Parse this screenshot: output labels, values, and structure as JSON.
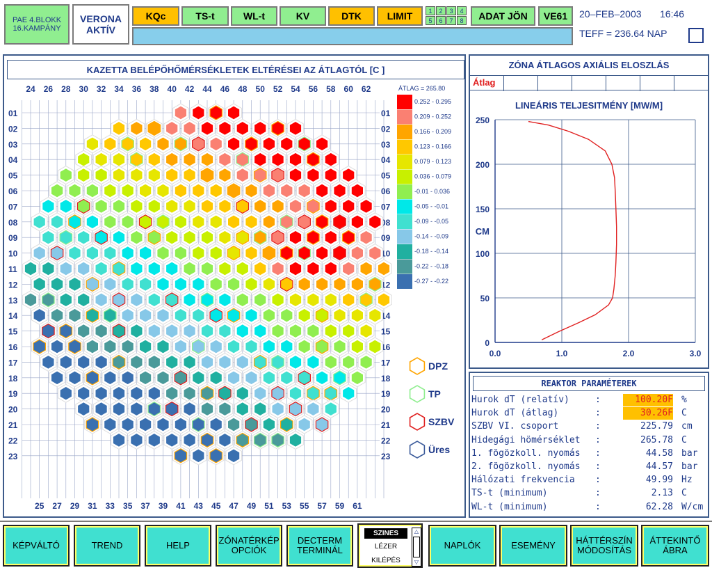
{
  "header": {
    "unit_line1": "PAE 4.BLOKK",
    "unit_line2": "16.KAMPÁNY",
    "status_line1": "VERONA",
    "status_line2": "AKTÍV",
    "buttons": [
      {
        "label": "KQc",
        "color": "yellow"
      },
      {
        "label": "TS-t",
        "color": "green"
      },
      {
        "label": "WL-t",
        "color": "green"
      },
      {
        "label": "KV",
        "color": "green"
      },
      {
        "label": "DTK",
        "color": "yellow"
      },
      {
        "label": "LIMIT",
        "color": "yellow"
      }
    ],
    "grid_numbers": [
      "1",
      "2",
      "3",
      "4",
      "5",
      "6",
      "7",
      "8"
    ],
    "adat_label": "ADAT JÖN",
    "ve_label": "VE61",
    "date": "20–FEB–2003",
    "time": "16:46",
    "teff": "TEFF = 236.64 NAP"
  },
  "map": {
    "title": "KAZETTA BELÉPŐHŐMÉRSÉKLETEK ELTÉRÉSEI AZ ÁTLAGTÓL  [C ]",
    "top_cols": [
      "24",
      "26",
      "28",
      "30",
      "32",
      "34",
      "36",
      "38",
      "40",
      "42",
      "44",
      "46",
      "48",
      "50",
      "52",
      "54",
      "56",
      "58",
      "60",
      "62"
    ],
    "bottom_cols": [
      "25",
      "27",
      "29",
      "31",
      "33",
      "35",
      "37",
      "39",
      "41",
      "43",
      "45",
      "47",
      "49",
      "51",
      "53",
      "55",
      "57",
      "59",
      "61"
    ],
    "rows": [
      "01",
      "02",
      "03",
      "04",
      "05",
      "06",
      "07",
      "08",
      "09",
      "10",
      "11",
      "12",
      "13",
      "14",
      "15",
      "16",
      "17",
      "18",
      "19",
      "20",
      "21",
      "22",
      "23"
    ],
    "legend_avg": "ÁTLAG = 265.80",
    "legend": [
      {
        "range": "0.252 -  0.295",
        "color": "#ff0000"
      },
      {
        "range": "0.209 -  0.252",
        "color": "#fa8072"
      },
      {
        "range": "0.166 -  0.209",
        "color": "#ffa500"
      },
      {
        "range": "0.123 -  0.166",
        "color": "#ffc800"
      },
      {
        "range": "0.079 -  0.123",
        "color": "#e6e600"
      },
      {
        "range": "0.036 -  0.079",
        "color": "#c8f000"
      },
      {
        "range": "-0.01 -  0.036",
        "color": "#90ee50"
      },
      {
        "range": "-0.05 -  -0.01",
        "color": "#00e8e8"
      },
      {
        "range": "-0.09 -  -0.05",
        "color": "#40e0d0"
      },
      {
        "range": "-0.14 -  -0.09",
        "color": "#87c8e8"
      },
      {
        "range": "-0.18 -  -0.14",
        "color": "#20b0a0"
      },
      {
        "range": "-0.22 -  -0.18",
        "color": "#4a9a9a"
      },
      {
        "range": "-0.27 -  -0.22",
        "color": "#3a70b0"
      }
    ],
    "types": [
      {
        "label": "DPZ",
        "color": "#ffa500"
      },
      {
        "label": "TP",
        "color": "#90ee90"
      },
      {
        "label": "SZBV",
        "color": "#e02020"
      },
      {
        "label": "Üres",
        "color": "#3a5a9a"
      }
    ]
  },
  "zone": {
    "title": "ZÓNA ÁTLAGOS AXIÁLIS ELOSZLÁS",
    "atlag": "Átlag",
    "chart_data": {
      "type": "line",
      "title": "LINEÁRIS TELJESITMÉNY [MW/M]",
      "ylabel": "CM",
      "xlim": [
        0,
        3
      ],
      "ylim": [
        0,
        250
      ],
      "xticks": [
        "0.0",
        "1.0",
        "2.0",
        "3.0"
      ],
      "yticks": [
        "0",
        "50",
        "100",
        "150",
        "200",
        "250"
      ],
      "x": [
        0.7,
        0.95,
        1.25,
        1.5,
        1.7,
        1.76,
        1.78,
        1.8,
        1.81,
        1.82,
        1.82,
        1.81,
        1.8,
        1.79,
        1.75,
        1.65,
        1.4,
        1.1,
        0.8,
        0.5
      ],
      "y": [
        3,
        12,
        22,
        31,
        42,
        50,
        60,
        75,
        90,
        110,
        130,
        150,
        170,
        185,
        200,
        215,
        228,
        237,
        244,
        248
      ],
      "series_color": "#e02020"
    }
  },
  "params": {
    "title": "REAKTOR PARAMÉTEREK",
    "rows": [
      {
        "label": "Hurok dT (relatív)",
        "value": "100.20F",
        "unit": "%",
        "highlight": true
      },
      {
        "label": "Hurok dT (átlag)",
        "value": "30.26F",
        "unit": "C",
        "highlight": true
      },
      {
        "label": "SZBV VI. csoport",
        "value": "225.79",
        "unit": "cm",
        "highlight": false
      },
      {
        "label": "Hidegági hömérséklet",
        "value": "265.78",
        "unit": "C",
        "highlight": false
      },
      {
        "label": "1. fögözkoll. nyomás",
        "value": "44.58",
        "unit": "bar",
        "highlight": false
      },
      {
        "label": "2. fögözkoll. nyomás",
        "value": "44.57",
        "unit": "bar",
        "highlight": false
      },
      {
        "label": "Hálózati frekvencia",
        "value": "49.99",
        "unit": "Hz",
        "highlight": false
      },
      {
        "label": "TS-t (minimum)",
        "value": "2.13",
        "unit": "C",
        "highlight": false
      },
      {
        "label": "WL-t (minimum)",
        "value": "62.28",
        "unit": "W/cm",
        "highlight": false
      }
    ]
  },
  "footer": {
    "buttons": [
      "KÉPVÁLTÓ",
      "TREND",
      "HELP",
      "ZÓNATÉRKÉP OPCIÓK",
      "DECTERM TERMINÁL"
    ],
    "buttons_right": [
      "NAPLÓK",
      "ESEMÉNY",
      "HÁTTÉRSZÍN MÓDOSÍTÁS",
      "ÁTTEKINTŐ ÁBRA"
    ],
    "print_options": [
      "SZINES",
      "LÉZER",
      "KILÉPÉS"
    ]
  }
}
